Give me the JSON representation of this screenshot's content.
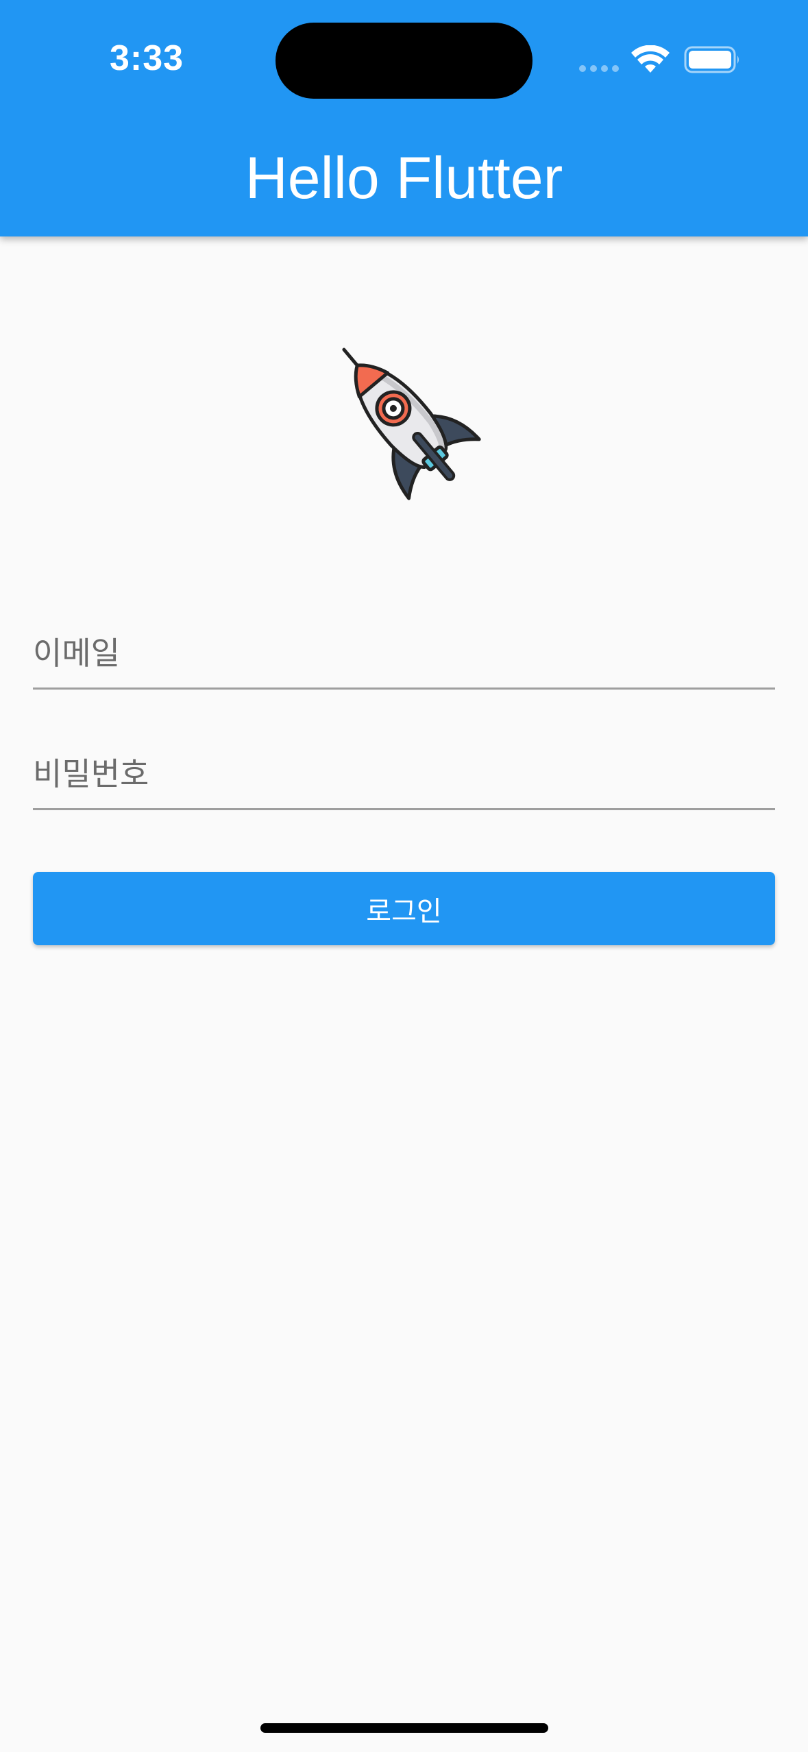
{
  "status_bar": {
    "time": "3:33",
    "icons": [
      "signal-icon",
      "wifi-icon",
      "battery-icon"
    ]
  },
  "app_bar": {
    "title": "Hello Flutter"
  },
  "hero": {
    "icon": "rocket-icon"
  },
  "form": {
    "email": {
      "placeholder": "이메일",
      "value": ""
    },
    "password": {
      "placeholder": "비밀번호",
      "value": ""
    },
    "login_label": "로그인"
  },
  "colors": {
    "primary": "#2196f3",
    "background": "#fafafa",
    "underline": "#9e9e9e",
    "rocket_nose": "#f26b50",
    "rocket_fin": "#3d4a5c",
    "rocket_window_accent": "#5bc8de"
  }
}
